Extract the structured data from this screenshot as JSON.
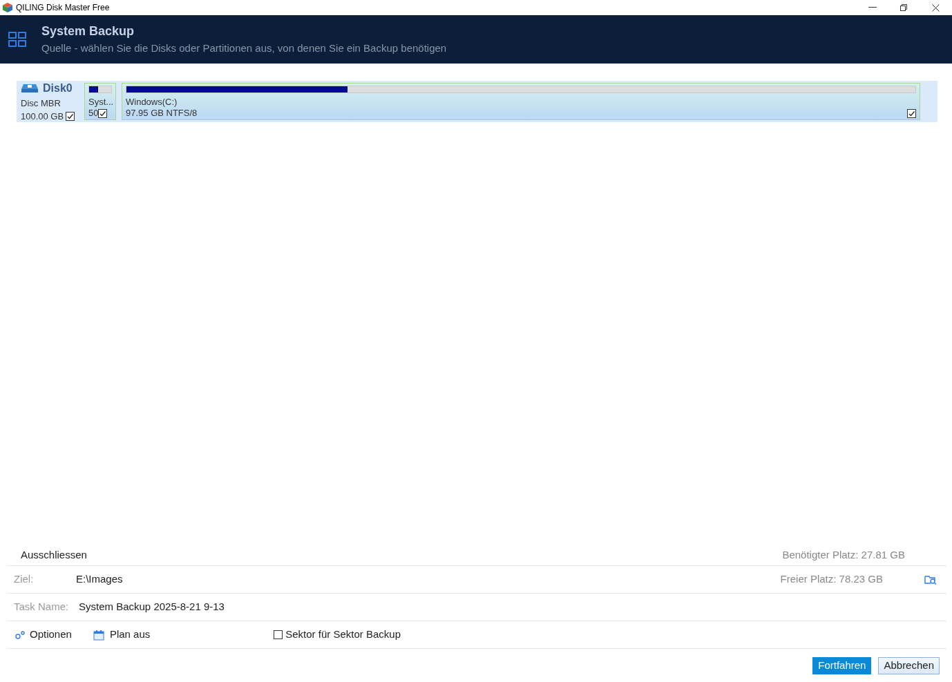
{
  "window": {
    "title": "QILING Disk Master Free"
  },
  "header": {
    "title": "System Backup",
    "subtitle": "Quelle - wählen Sie die Disks oder Partitionen aus, von denen Sie ein Backup benötigen"
  },
  "disk": {
    "name": "Disk0",
    "type": "Disc MBR",
    "size": "100.00 GB",
    "checked": true,
    "partitions": [
      {
        "label": "Syst...",
        "size": "50",
        "level": 0.4,
        "checked": true,
        "wide": false
      },
      {
        "label": "Windows(C:)",
        "size": "97.95 GB NTFS/8",
        "level": 0.28,
        "checked": true,
        "wide": true
      }
    ]
  },
  "exclude": {
    "label": "Ausschliessen",
    "required": "Benötigter Platz: 27.81 GB"
  },
  "target": {
    "label": "Ziel:",
    "value": "E:\\Images",
    "free": "Freier Platz: 78.23 GB"
  },
  "task": {
    "label": "Task Name:",
    "value": "System Backup 2025-8-21 9-13"
  },
  "options": {
    "options_label": "Optionen",
    "plan_label": "Plan aus",
    "sector": {
      "label": "Sektor für Sektor Backup",
      "checked": false
    }
  },
  "buttons": [
    {
      "label": "Fortfahren",
      "primary": true
    },
    {
      "label": "Abbrechen",
      "primary": false
    }
  ]
}
